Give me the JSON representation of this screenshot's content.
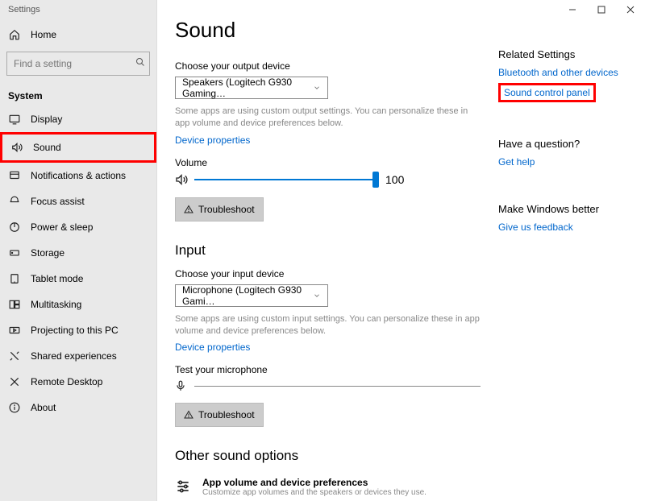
{
  "window": {
    "title": "Settings"
  },
  "sidebar": {
    "home": "Home",
    "search_placeholder": "Find a setting",
    "heading": "System",
    "items": [
      {
        "label": "Display"
      },
      {
        "label": "Sound"
      },
      {
        "label": "Notifications & actions"
      },
      {
        "label": "Focus assist"
      },
      {
        "label": "Power & sleep"
      },
      {
        "label": "Storage"
      },
      {
        "label": "Tablet mode"
      },
      {
        "label": "Multitasking"
      },
      {
        "label": "Projecting to this PC"
      },
      {
        "label": "Shared experiences"
      },
      {
        "label": "Remote Desktop"
      },
      {
        "label": "About"
      }
    ]
  },
  "main": {
    "title": "Sound",
    "output": {
      "choose_label": "Choose your output device",
      "device": "Speakers (Logitech G930 Gaming…",
      "helper": "Some apps are using custom output settings. You can personalize these in app volume and device preferences below.",
      "device_properties": "Device properties",
      "volume_label": "Volume",
      "volume_value": "100",
      "troubleshoot": "Troubleshoot"
    },
    "input": {
      "heading": "Input",
      "choose_label": "Choose your input device",
      "device": "Microphone (Logitech G930 Gami…",
      "helper": "Some apps are using custom input settings. You can personalize these in app volume and device preferences below.",
      "device_properties": "Device properties",
      "test_label": "Test your microphone",
      "troubleshoot": "Troubleshoot"
    },
    "other": {
      "heading": "Other sound options",
      "row1_title": "App volume and device preferences",
      "row1_sub": "Customize app volumes and the speakers or devices they use."
    }
  },
  "aside": {
    "related_heading": "Related Settings",
    "bluetooth": "Bluetooth and other devices",
    "sound_control": "Sound control panel",
    "question_heading": "Have a question?",
    "get_help": "Get help",
    "better_heading": "Make Windows better",
    "feedback": "Give us feedback"
  }
}
